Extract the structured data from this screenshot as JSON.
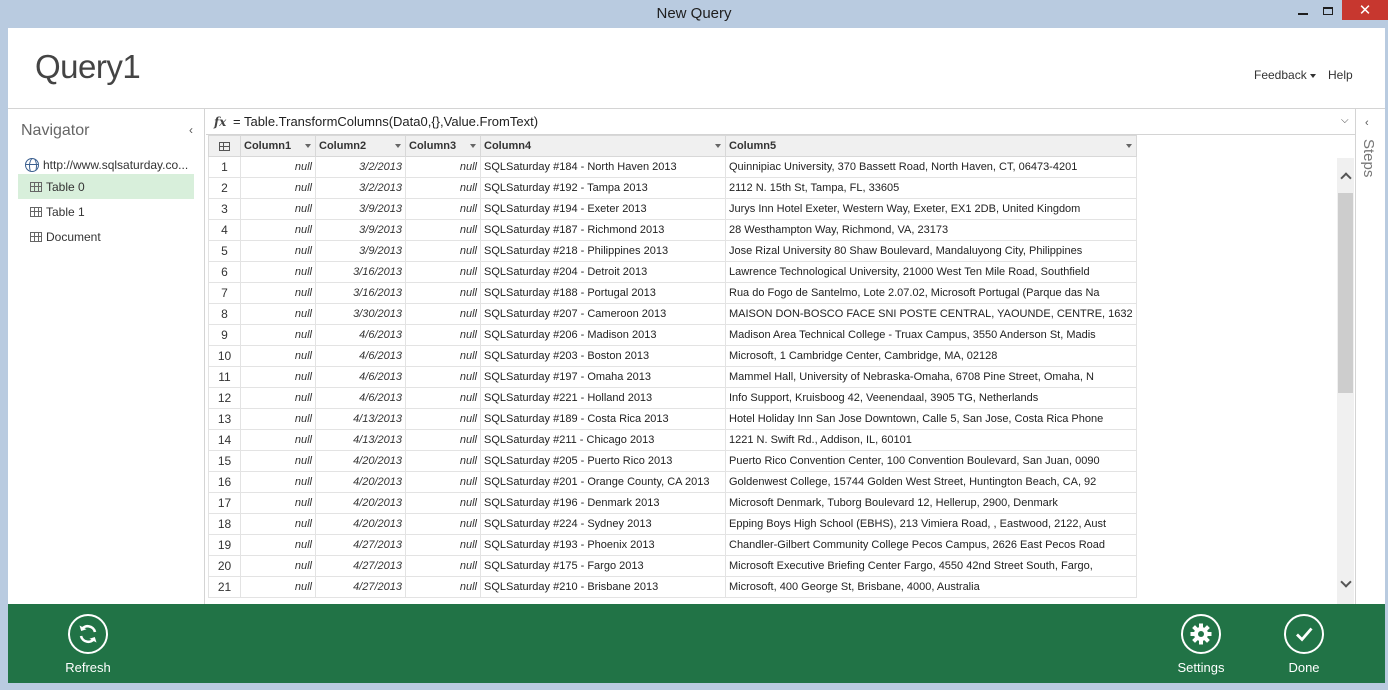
{
  "window": {
    "title": "New Query"
  },
  "header": {
    "query_name": "Query1",
    "feedback": "Feedback",
    "help": "Help"
  },
  "navigator": {
    "title": "Navigator",
    "source": "http://www.sqlsaturday.co...",
    "items": [
      {
        "label": "Table 0",
        "selected": true
      },
      {
        "label": "Table 1",
        "selected": false
      },
      {
        "label": "Document",
        "selected": false
      }
    ]
  },
  "formula": {
    "fx": "fx",
    "text": "= Table.TransformColumns(Data0,{},Value.FromText)"
  },
  "steps": {
    "label": "Steps"
  },
  "grid": {
    "columns": [
      "Column1",
      "Column2",
      "Column3",
      "Column4",
      "Column5"
    ],
    "rows": [
      [
        "1",
        "null",
        "3/2/2013",
        "null",
        "SQLSaturday #184 - North Haven 2013",
        "Quinnipiac University, 370 Bassett Road, North Haven, CT, 06473-4201"
      ],
      [
        "2",
        "null",
        "3/2/2013",
        "null",
        "SQLSaturday #192 - Tampa 2013",
        "2112 N. 15th St, Tampa, FL, 33605"
      ],
      [
        "3",
        "null",
        "3/9/2013",
        "null",
        "SQLSaturday #194 - Exeter 2013",
        "Jurys Inn Hotel Exeter, Western Way, Exeter, EX1 2DB, United Kingdom"
      ],
      [
        "4",
        "null",
        "3/9/2013",
        "null",
        "SQLSaturday #187 - Richmond 2013",
        "28 Westhampton Way, Richmond, VA, 23173"
      ],
      [
        "5",
        "null",
        "3/9/2013",
        "null",
        "SQLSaturday #218 - Philippines 2013",
        "Jose Rizal University 80 Shaw Boulevard, Mandaluyong City, Philippines"
      ],
      [
        "6",
        "null",
        "3/16/2013",
        "null",
        "SQLSaturday #204 - Detroit 2013",
        "Lawrence Technological University, 21000 West Ten Mile Road, Southfield"
      ],
      [
        "7",
        "null",
        "3/16/2013",
        "null",
        "SQLSaturday #188 - Portugal 2013",
        "Rua do Fogo de Santelmo, Lote 2.07.02, Microsoft Portugal (Parque das Na"
      ],
      [
        "8",
        "null",
        "3/30/2013",
        "null",
        "SQLSaturday #207 - Cameroon 2013",
        "MAISON DON-BOSCO FACE SNI POSTE CENTRAL, YAOUNDE, CENTRE, 1632"
      ],
      [
        "9",
        "null",
        "4/6/2013",
        "null",
        "SQLSaturday #206 - Madison 2013",
        "Madison Area Technical College - Truax Campus, 3550 Anderson St, Madis"
      ],
      [
        "10",
        "null",
        "4/6/2013",
        "null",
        "SQLSaturday #203 - Boston 2013",
        "Microsoft, 1 Cambridge Center, Cambridge, MA, 02128"
      ],
      [
        "11",
        "null",
        "4/6/2013",
        "null",
        "SQLSaturday #197 - Omaha 2013",
        "Mammel Hall, University of Nebraska-Omaha, 6708 Pine Street, Omaha, N"
      ],
      [
        "12",
        "null",
        "4/6/2013",
        "null",
        "SQLSaturday #221 - Holland 2013",
        "Info Support, Kruisboog 42, Veenendaal, 3905 TG, Netherlands"
      ],
      [
        "13",
        "null",
        "4/13/2013",
        "null",
        "SQLSaturday #189 - Costa Rica 2013",
        "Hotel Holiday Inn San Jose Downtown, Calle 5, San Jose, Costa Rica Phone"
      ],
      [
        "14",
        "null",
        "4/13/2013",
        "null",
        "SQLSaturday #211 - Chicago 2013",
        "1221 N. Swift Rd., Addison, IL, 60101"
      ],
      [
        "15",
        "null",
        "4/20/2013",
        "null",
        "SQLSaturday #205 - Puerto Rico 2013",
        "Puerto Rico Convention Center, 100 Convention Boulevard, San Juan, 0090"
      ],
      [
        "16",
        "null",
        "4/20/2013",
        "null",
        "SQLSaturday #201 - Orange County, CA 2013",
        "Goldenwest College, 15744 Golden West Street, Huntington Beach, CA, 92"
      ],
      [
        "17",
        "null",
        "4/20/2013",
        "null",
        "SQLSaturday #196 - Denmark 2013",
        "Microsoft Denmark, Tuborg Boulevard 12, Hellerup, 2900, Denmark"
      ],
      [
        "18",
        "null",
        "4/20/2013",
        "null",
        "SQLSaturday #224 - Sydney 2013",
        "Epping Boys High School (EBHS), 213 Vimiera Road, , Eastwood, 2122, Aust"
      ],
      [
        "19",
        "null",
        "4/27/2013",
        "null",
        "SQLSaturday #193 - Phoenix 2013",
        "Chandler-Gilbert Community College Pecos Campus, 2626 East Pecos Road"
      ],
      [
        "20",
        "null",
        "4/27/2013",
        "null",
        "SQLSaturday #175 - Fargo 2013",
        "Microsoft Executive Briefing Center Fargo, 4550 42nd Street South, Fargo,"
      ],
      [
        "21",
        "null",
        "4/27/2013",
        "null",
        "SQLSaturday #210 - Brisbane 2013",
        "Microsoft, 400 George St, Brisbane, 4000, Australia"
      ]
    ]
  },
  "footer": {
    "refresh": "Refresh",
    "settings": "Settings",
    "done": "Done"
  },
  "colors": {
    "accent": "#217346",
    "selection": "#d8efdb",
    "chrome": "#b9cbe0",
    "close": "#c7372f"
  },
  "icons": {
    "source": "globe-icon",
    "table": "table-icon",
    "refresh": "refresh-icon",
    "settings": "gear-icon",
    "done": "checkmark-icon"
  }
}
